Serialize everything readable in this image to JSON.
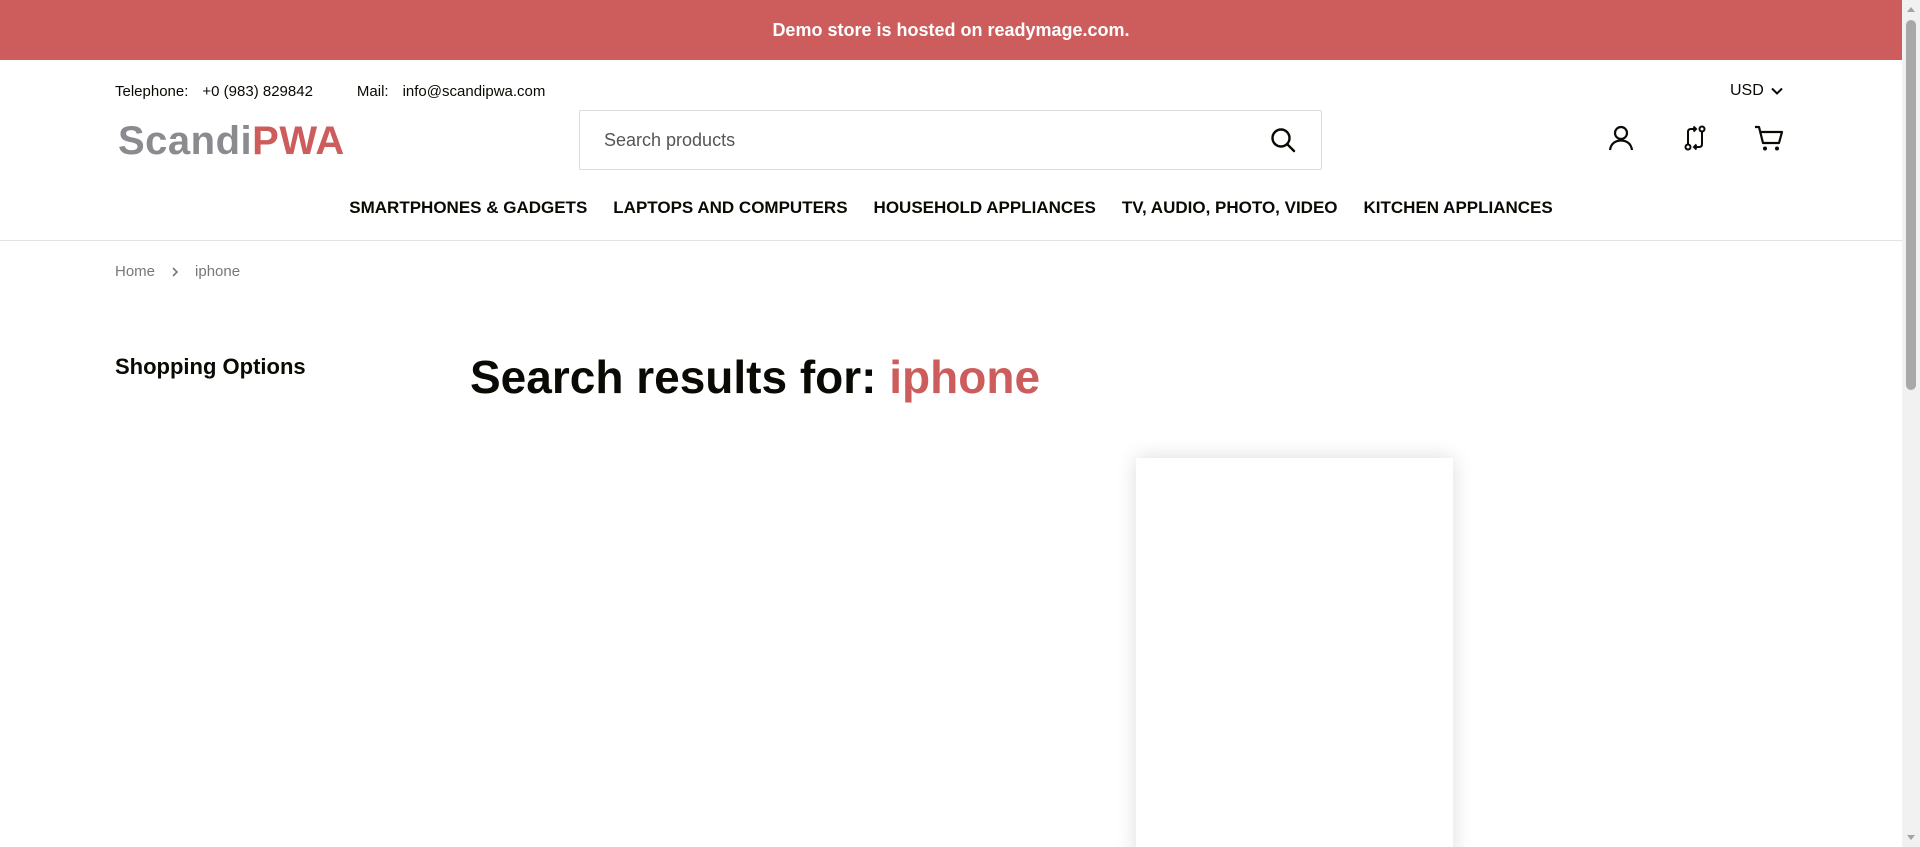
{
  "banner": {
    "text": "Demo store is hosted on readymage.com."
  },
  "contact": {
    "telephone_label": "Telephone:",
    "telephone_value": "+0 (983) 829842",
    "mail_label": "Mail:",
    "mail_value": "info@scandipwa.com"
  },
  "currency": {
    "selected": "USD"
  },
  "logo": {
    "part1": "Scandi",
    "part2": "PWA"
  },
  "search": {
    "placeholder": "Search products",
    "value": ""
  },
  "header_icons": [
    "account-icon",
    "compare-icon",
    "cart-icon"
  ],
  "nav": {
    "items": [
      {
        "label": "Smartphones & Gadgets"
      },
      {
        "label": "Laptops and computers"
      },
      {
        "label": "Household appliances"
      },
      {
        "label": "TV, audio, photo, video"
      },
      {
        "label": "Kitchen appliances"
      }
    ]
  },
  "breadcrumb": {
    "home": "Home",
    "current": "iphone"
  },
  "sidebar": {
    "title": "Shopping Options"
  },
  "results": {
    "prefix": "Search results for:",
    "term": "iphone"
  },
  "colors": {
    "accent": "#cd5c5c",
    "text": "#0a0903",
    "logo_gray": "#8a8a8f"
  }
}
